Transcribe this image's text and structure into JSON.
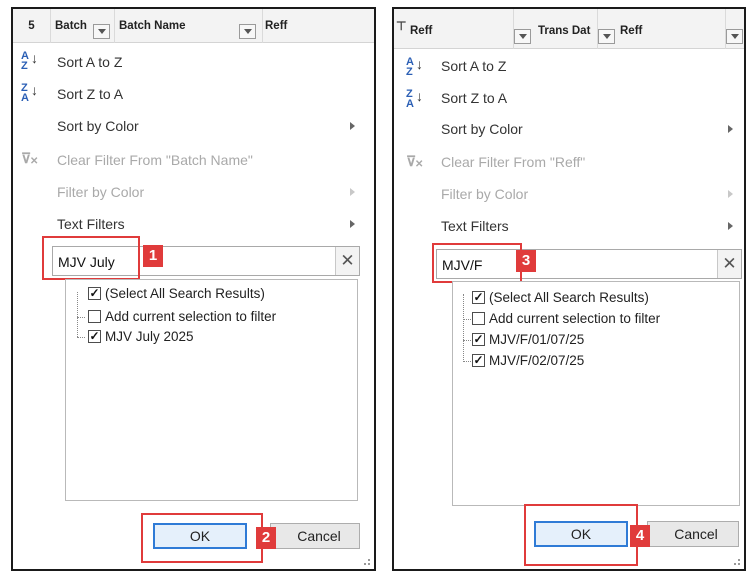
{
  "left": {
    "header": {
      "col0": "5",
      "col1": "Batch",
      "col2": "Batch Name",
      "col3": "Reff"
    },
    "menu": {
      "sort_az": "Sort A to Z",
      "sort_za": "Sort Z to A",
      "sort_color": "Sort by Color",
      "clear_filter": "Clear Filter From \"Batch Name\"",
      "filter_color": "Filter by Color",
      "text_filters": "Text Filters"
    },
    "search": {
      "value": "MJV July",
      "clear_label": "✕"
    },
    "list": {
      "items": [
        {
          "label": "(Select All Search Results)",
          "checked": true
        },
        {
          "label": "Add current selection to filter",
          "checked": false
        },
        {
          "label": "MJV July 2025",
          "checked": true
        }
      ]
    },
    "buttons": {
      "ok": "OK",
      "cancel": "Cancel"
    },
    "badges": {
      "search": "1",
      "ok": "2"
    }
  },
  "right": {
    "header": {
      "col1": "Reff",
      "col2": "Trans Dat",
      "col3": "Reff"
    },
    "menu": {
      "sort_az": "Sort A to Z",
      "sort_za": "Sort Z to A",
      "sort_color": "Sort by Color",
      "clear_filter": "Clear Filter From \"Reff\"",
      "filter_color": "Filter by Color",
      "text_filters": "Text Filters"
    },
    "search": {
      "value": "MJV/F",
      "clear_label": "✕"
    },
    "list": {
      "items": [
        {
          "label": "(Select All Search Results)",
          "checked": true
        },
        {
          "label": "Add current selection to filter",
          "checked": false
        },
        {
          "label": "MJV/F/01/07/25",
          "checked": true
        },
        {
          "label": "MJV/F/02/07/25",
          "checked": true
        }
      ]
    },
    "buttons": {
      "ok": "OK",
      "cancel": "Cancel"
    },
    "badges": {
      "search": "3",
      "ok": "4"
    }
  },
  "colors": {
    "callout": "#e03b3b",
    "ok_border": "#2f7bd6",
    "disabled_text": "#a9a9a9"
  },
  "icons": {
    "sort_az": "sort-a-z-icon",
    "sort_za": "sort-z-a-icon",
    "clear_filter": "clear-filter-icon",
    "submenu": "chevron-right-icon",
    "clear_search": "close-icon",
    "dropdown": "dropdown-arrow-icon"
  }
}
